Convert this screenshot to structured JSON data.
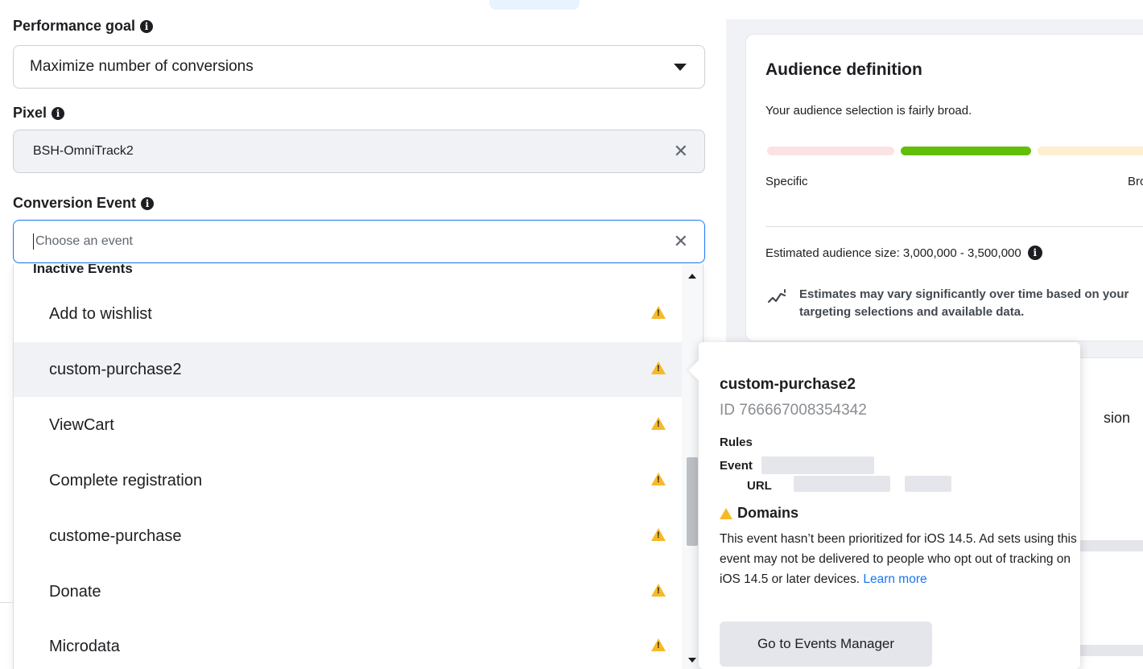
{
  "performance_goal": {
    "label": "Performance goal",
    "value": "Maximize number of conversions"
  },
  "pixel": {
    "label": "Pixel",
    "value": "BSH-OmniTrack2"
  },
  "conversion_event": {
    "label": "Conversion Event",
    "placeholder": "Choose an event",
    "dropdown": {
      "section_header": "Inactive Events",
      "items": [
        {
          "label": "Add to wishlist"
        },
        {
          "label": "custom-purchase2"
        },
        {
          "label": "ViewCart"
        },
        {
          "label": "Complete registration"
        },
        {
          "label": "custome-purchase"
        },
        {
          "label": "Donate"
        },
        {
          "label": "Microdata"
        }
      ],
      "hovered_index": 1
    }
  },
  "tooltip": {
    "title": "custom-purchase2",
    "id_text": "ID 766667008354342",
    "rules_label": "Rules",
    "event_label": "Event",
    "url_label": "URL",
    "domains_label": "Domains",
    "body": "This event hasn’t been prioritized for iOS 14.5. Ad sets using this event may not be delivered to people who opt out of tracking on iOS 14.5 or later devices.",
    "link_text": "Learn more",
    "button_label": "Go to Events Manager"
  },
  "audience": {
    "title": "Audience definition",
    "subtitle": "Your audience selection is fairly broad.",
    "specific_label": "Specific",
    "broad_label": "Bro",
    "estimate_text": "Estimated audience size: 3,000,000 - 3,500,000",
    "note": "Estimates may vary significantly over time based on your targeting selections and available data.",
    "card2_text": "sion"
  },
  "colors": {
    "accent": "#1877f2",
    "warning": "#f7b928",
    "meter_green": "#63be09"
  }
}
